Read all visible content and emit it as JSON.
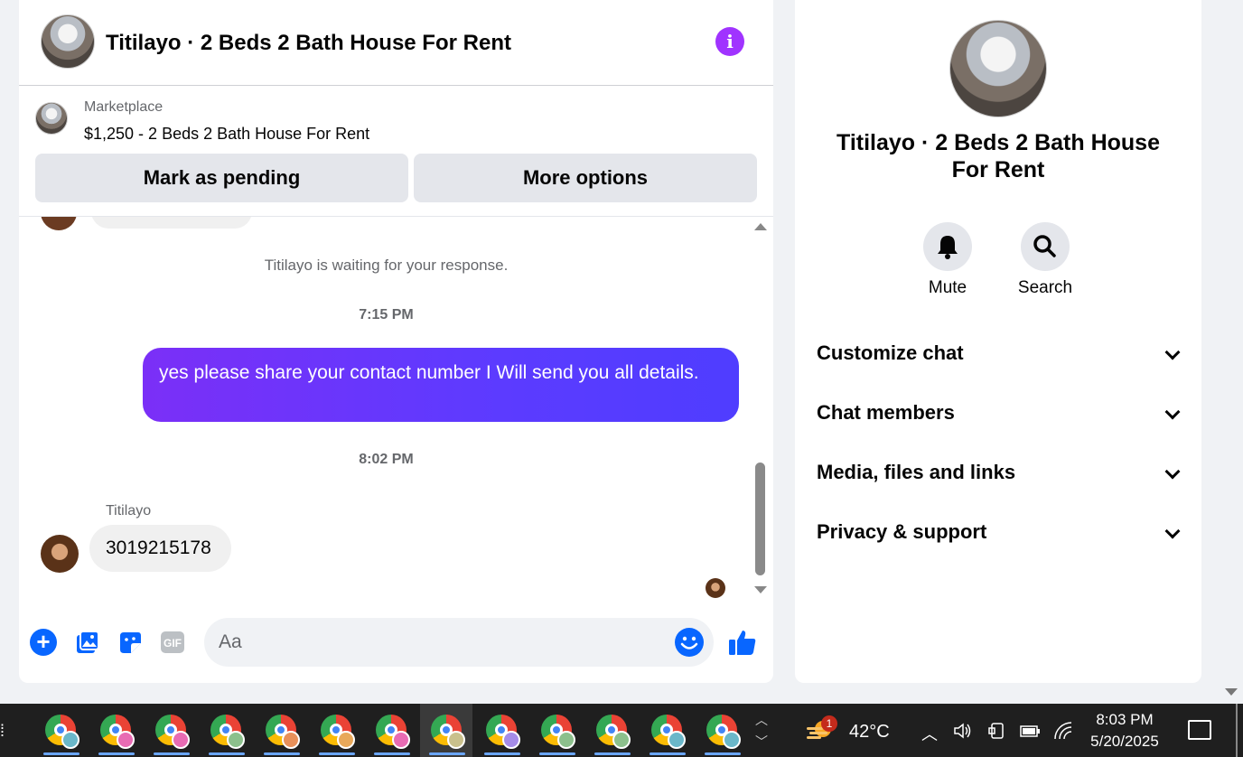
{
  "chat": {
    "title": "Titilayo · 2 Beds 2 Bath House For Rent",
    "marketplace_label": "Marketplace",
    "listing": "$1,250 - 2 Beds 2 Bath House For Rent",
    "mark_pending_label": "Mark as pending",
    "more_options_label": "More options",
    "waiting_text": "Titilayo is waiting for your response.",
    "time_1": "7:15 PM",
    "outgoing_message": "yes please share your contact number I Will send you all details.",
    "time_2": "8:02 PM",
    "sender_name": "Titilayo",
    "incoming_message": "3019215178",
    "input_placeholder": "Aa"
  },
  "info_panel": {
    "title": "Titilayo · 2 Beds 2 Bath House For Rent",
    "actions": [
      {
        "label": "Mute",
        "icon": "bell-icon"
      },
      {
        "label": "Search",
        "icon": "search-icon"
      }
    ],
    "sections": [
      "Customize chat",
      "Chat members",
      "Media, files and links",
      "Privacy & support"
    ]
  },
  "taskbar": {
    "weather_badge": "1",
    "temperature": "42°C",
    "time": "8:03 PM",
    "date": "5/20/2025",
    "profile_colors": [
      "#6ab7c9",
      "#e86bb3",
      "#e86bb3",
      "#8cc08c",
      "#e8905a",
      "#e8a85a",
      "#e86bb3",
      "#c9c08c",
      "#a58ce8",
      "#8cc08c",
      "#8cc08c",
      "#6ab7c9",
      "#6ab7c9"
    ]
  },
  "colors": {
    "accent": "#0866ff",
    "outgoing_start": "#7b2ff7",
    "outgoing_end": "#4f3dff",
    "info_purple": "#a033ff"
  }
}
